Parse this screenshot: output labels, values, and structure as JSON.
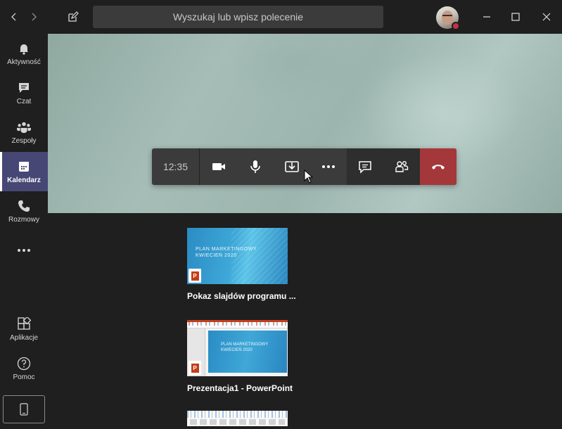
{
  "titlebar": {
    "search_placeholder": "Wyszukaj lub wpisz polecenie"
  },
  "rail": {
    "items": [
      {
        "label": "Aktywność",
        "icon": "bell-icon"
      },
      {
        "label": "Czat",
        "icon": "chat-icon"
      },
      {
        "label": "Zespoły",
        "icon": "teams-icon"
      },
      {
        "label": "Kalendarz",
        "icon": "calendar-icon",
        "active": true
      },
      {
        "label": "Rozmowy",
        "icon": "phone-icon"
      },
      {
        "label": "Aplikacje",
        "icon": "apps-icon"
      },
      {
        "label": "Pomoc",
        "icon": "help-icon"
      }
    ]
  },
  "call": {
    "duration": "12:35",
    "accent_hangup": "#a4373a"
  },
  "share_tray": {
    "items": [
      {
        "label": "Pokaz slajdów programu ...",
        "slide_title_line1": "PLAN MARKETINGOWY",
        "slide_title_line2": "KWIECIEŃ 2020",
        "app_badge": "P"
      },
      {
        "label": "Prezentacja1 - PowerPoint",
        "slide_title_line1": "PLAN MARKETINGOWY",
        "slide_title_line2": "KWIECIEŃ 2020",
        "app_badge": "P"
      }
    ]
  },
  "colors": {
    "rail_active": "#464775",
    "presence_busy": "#c4314b"
  }
}
